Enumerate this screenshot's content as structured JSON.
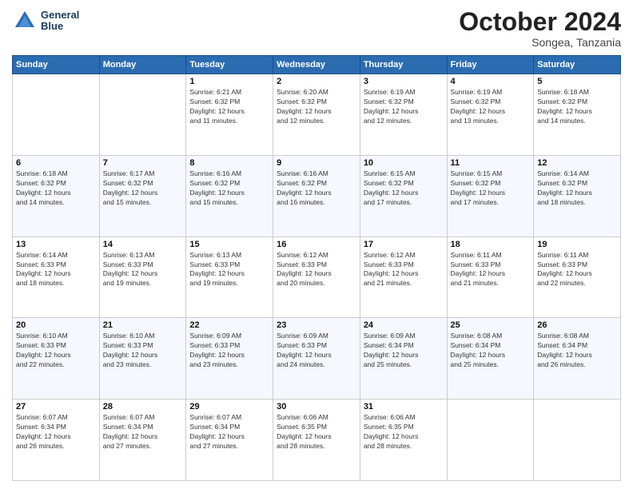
{
  "header": {
    "logo_line1": "General",
    "logo_line2": "Blue",
    "month": "October 2024",
    "location": "Songea, Tanzania"
  },
  "weekdays": [
    "Sunday",
    "Monday",
    "Tuesday",
    "Wednesday",
    "Thursday",
    "Friday",
    "Saturday"
  ],
  "weeks": [
    [
      {
        "day": "",
        "info": ""
      },
      {
        "day": "",
        "info": ""
      },
      {
        "day": "1",
        "info": "Sunrise: 6:21 AM\nSunset: 6:32 PM\nDaylight: 12 hours\nand 11 minutes."
      },
      {
        "day": "2",
        "info": "Sunrise: 6:20 AM\nSunset: 6:32 PM\nDaylight: 12 hours\nand 12 minutes."
      },
      {
        "day": "3",
        "info": "Sunrise: 6:19 AM\nSunset: 6:32 PM\nDaylight: 12 hours\nand 12 minutes."
      },
      {
        "day": "4",
        "info": "Sunrise: 6:19 AM\nSunset: 6:32 PM\nDaylight: 12 hours\nand 13 minutes."
      },
      {
        "day": "5",
        "info": "Sunrise: 6:18 AM\nSunset: 6:32 PM\nDaylight: 12 hours\nand 14 minutes."
      }
    ],
    [
      {
        "day": "6",
        "info": "Sunrise: 6:18 AM\nSunset: 6:32 PM\nDaylight: 12 hours\nand 14 minutes."
      },
      {
        "day": "7",
        "info": "Sunrise: 6:17 AM\nSunset: 6:32 PM\nDaylight: 12 hours\nand 15 minutes."
      },
      {
        "day": "8",
        "info": "Sunrise: 6:16 AM\nSunset: 6:32 PM\nDaylight: 12 hours\nand 15 minutes."
      },
      {
        "day": "9",
        "info": "Sunrise: 6:16 AM\nSunset: 6:32 PM\nDaylight: 12 hours\nand 16 minutes."
      },
      {
        "day": "10",
        "info": "Sunrise: 6:15 AM\nSunset: 6:32 PM\nDaylight: 12 hours\nand 17 minutes."
      },
      {
        "day": "11",
        "info": "Sunrise: 6:15 AM\nSunset: 6:32 PM\nDaylight: 12 hours\nand 17 minutes."
      },
      {
        "day": "12",
        "info": "Sunrise: 6:14 AM\nSunset: 6:32 PM\nDaylight: 12 hours\nand 18 minutes."
      }
    ],
    [
      {
        "day": "13",
        "info": "Sunrise: 6:14 AM\nSunset: 6:33 PM\nDaylight: 12 hours\nand 18 minutes."
      },
      {
        "day": "14",
        "info": "Sunrise: 6:13 AM\nSunset: 6:33 PM\nDaylight: 12 hours\nand 19 minutes."
      },
      {
        "day": "15",
        "info": "Sunrise: 6:13 AM\nSunset: 6:33 PM\nDaylight: 12 hours\nand 19 minutes."
      },
      {
        "day": "16",
        "info": "Sunrise: 6:12 AM\nSunset: 6:33 PM\nDaylight: 12 hours\nand 20 minutes."
      },
      {
        "day": "17",
        "info": "Sunrise: 6:12 AM\nSunset: 6:33 PM\nDaylight: 12 hours\nand 21 minutes."
      },
      {
        "day": "18",
        "info": "Sunrise: 6:11 AM\nSunset: 6:33 PM\nDaylight: 12 hours\nand 21 minutes."
      },
      {
        "day": "19",
        "info": "Sunrise: 6:11 AM\nSunset: 6:33 PM\nDaylight: 12 hours\nand 22 minutes."
      }
    ],
    [
      {
        "day": "20",
        "info": "Sunrise: 6:10 AM\nSunset: 6:33 PM\nDaylight: 12 hours\nand 22 minutes."
      },
      {
        "day": "21",
        "info": "Sunrise: 6:10 AM\nSunset: 6:33 PM\nDaylight: 12 hours\nand 23 minutes."
      },
      {
        "day": "22",
        "info": "Sunrise: 6:09 AM\nSunset: 6:33 PM\nDaylight: 12 hours\nand 23 minutes."
      },
      {
        "day": "23",
        "info": "Sunrise: 6:09 AM\nSunset: 6:33 PM\nDaylight: 12 hours\nand 24 minutes."
      },
      {
        "day": "24",
        "info": "Sunrise: 6:09 AM\nSunset: 6:34 PM\nDaylight: 12 hours\nand 25 minutes."
      },
      {
        "day": "25",
        "info": "Sunrise: 6:08 AM\nSunset: 6:34 PM\nDaylight: 12 hours\nand 25 minutes."
      },
      {
        "day": "26",
        "info": "Sunrise: 6:08 AM\nSunset: 6:34 PM\nDaylight: 12 hours\nand 26 minutes."
      }
    ],
    [
      {
        "day": "27",
        "info": "Sunrise: 6:07 AM\nSunset: 6:34 PM\nDaylight: 12 hours\nand 26 minutes."
      },
      {
        "day": "28",
        "info": "Sunrise: 6:07 AM\nSunset: 6:34 PM\nDaylight: 12 hours\nand 27 minutes."
      },
      {
        "day": "29",
        "info": "Sunrise: 6:07 AM\nSunset: 6:34 PM\nDaylight: 12 hours\nand 27 minutes."
      },
      {
        "day": "30",
        "info": "Sunrise: 6:06 AM\nSunset: 6:35 PM\nDaylight: 12 hours\nand 28 minutes."
      },
      {
        "day": "31",
        "info": "Sunrise: 6:06 AM\nSunset: 6:35 PM\nDaylight: 12 hours\nand 28 minutes."
      },
      {
        "day": "",
        "info": ""
      },
      {
        "day": "",
        "info": ""
      }
    ]
  ]
}
